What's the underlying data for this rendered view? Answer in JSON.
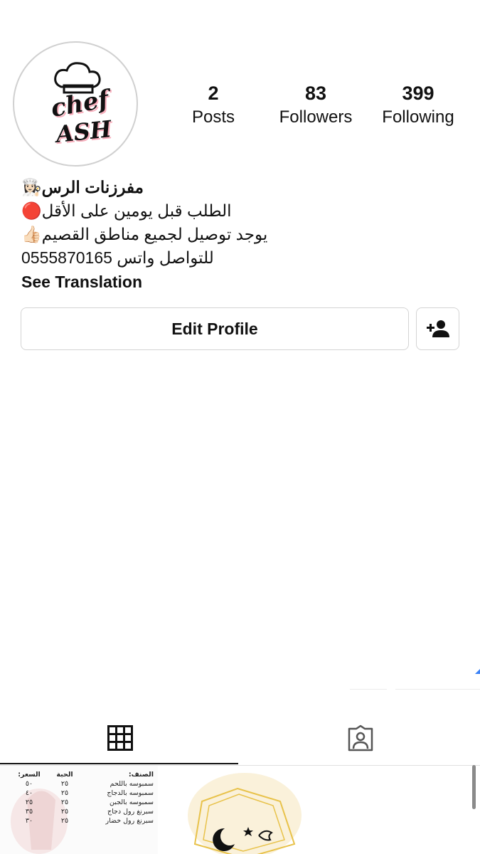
{
  "profile": {
    "avatar_text_top": "chef",
    "avatar_text_bottom": "ASH",
    "stats": [
      {
        "value": "2",
        "label": "Posts"
      },
      {
        "value": "83",
        "label": "Followers"
      },
      {
        "value": "399",
        "label": "Following"
      }
    ],
    "bio": {
      "name": "مفرزنات الرس👩🏻‍🍳",
      "lines": [
        "الطلب قبل يومين على الأقل🔴",
        "يوجد توصيل لجميع مناطق القصيم👍🏻",
        "للتواصل واتس 0555870165"
      ],
      "see_translation": "See Translation"
    },
    "edit_profile_label": "Edit Profile"
  },
  "tabs": [
    {
      "icon": "grid-icon",
      "active": true
    },
    {
      "icon": "tagged-icon",
      "active": false
    }
  ],
  "posts": {
    "menu": {
      "headers": [
        "الصنف:",
        "الحبة",
        "السعر:"
      ],
      "rows": [
        [
          "سمبوسه باللحم",
          "٢٥",
          "٥٠"
        ],
        [
          "سمبوسه بالدجاج",
          "٢٥",
          "٤٠"
        ],
        [
          "سمبوسه بالجبن",
          "٢٥",
          "٢٥"
        ],
        [
          "سبرنغ رول دجاج",
          "٢٥",
          "٣٥"
        ],
        [
          "سبرنغ رول خضار",
          "٢٥",
          "٣٠"
        ]
      ]
    }
  },
  "colors": {
    "text": "#111111",
    "border": "#d4d4d4",
    "avatar_border": "#d0d0d0",
    "accent_pink": "#f26c86",
    "gold": "#e8c24a"
  }
}
